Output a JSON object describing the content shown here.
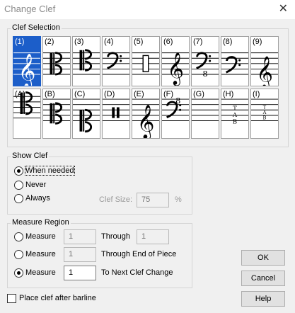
{
  "window": {
    "title": "Change Clef",
    "close_glyph": "✕"
  },
  "clef_selection": {
    "legend": "Clef Selection",
    "selected_index": 0,
    "row1": [
      {
        "label": "(1)",
        "icon": "treble-clef-icon"
      },
      {
        "label": "(2)",
        "icon": "alto-clef-icon"
      },
      {
        "label": "(3)",
        "icon": "tenor-clef-icon"
      },
      {
        "label": "(4)",
        "icon": "bass-clef-icon"
      },
      {
        "label": "(5)",
        "icon": "percussion-clef-icon"
      },
      {
        "label": "(6)",
        "icon": "treble-clef-high-icon"
      },
      {
        "label": "(7)",
        "icon": "bass-8vb-clef-icon"
      },
      {
        "label": "(8)",
        "icon": "bass-clef-low-icon"
      },
      {
        "label": "(9)",
        "icon": "french-violin-clef-icon"
      }
    ],
    "row2": [
      {
        "label": "(A)",
        "icon": "c-clef-icon"
      },
      {
        "label": "(B)",
        "icon": "c-clef-low-icon"
      },
      {
        "label": "(C)",
        "icon": "c-clef-lower-icon"
      },
      {
        "label": "(D)",
        "icon": "percussion-clef-2-icon"
      },
      {
        "label": "(E)",
        "icon": "treble-clef-low-icon"
      },
      {
        "label": "(F)",
        "icon": "bass-8va-clef-icon"
      },
      {
        "label": "(G)",
        "icon": "blank-clef-icon"
      },
      {
        "label": "(H)",
        "icon": "tab-clef-icon"
      },
      {
        "label": "(I)",
        "icon": "tab-clef-small-icon"
      }
    ],
    "tab_text": {
      "t": "T",
      "a": "A",
      "b": "B"
    },
    "octave_mark": "8"
  },
  "show_clef": {
    "legend": "Show Clef",
    "options": [
      {
        "label": "When needed",
        "selected": true
      },
      {
        "label": "Never",
        "selected": false
      },
      {
        "label": "Always",
        "selected": false
      }
    ],
    "clef_size_label": "Clef Size:",
    "clef_size_value": "75",
    "clef_size_unit": "%"
  },
  "measure_region": {
    "legend": "Measure Region",
    "rows": [
      {
        "radio_label": "Measure",
        "value": "1",
        "selected": false,
        "suffix": "Through",
        "through_value": "1"
      },
      {
        "radio_label": "Measure",
        "value": "1",
        "selected": false,
        "suffix": "Through End of Piece"
      },
      {
        "radio_label": "Measure",
        "value": "1",
        "selected": true,
        "suffix": "To Next Clef Change"
      }
    ]
  },
  "place_after_barline": {
    "label": "Place clef after barline",
    "checked": false
  },
  "buttons": {
    "ok": "OK",
    "cancel": "Cancel",
    "help": "Help"
  }
}
